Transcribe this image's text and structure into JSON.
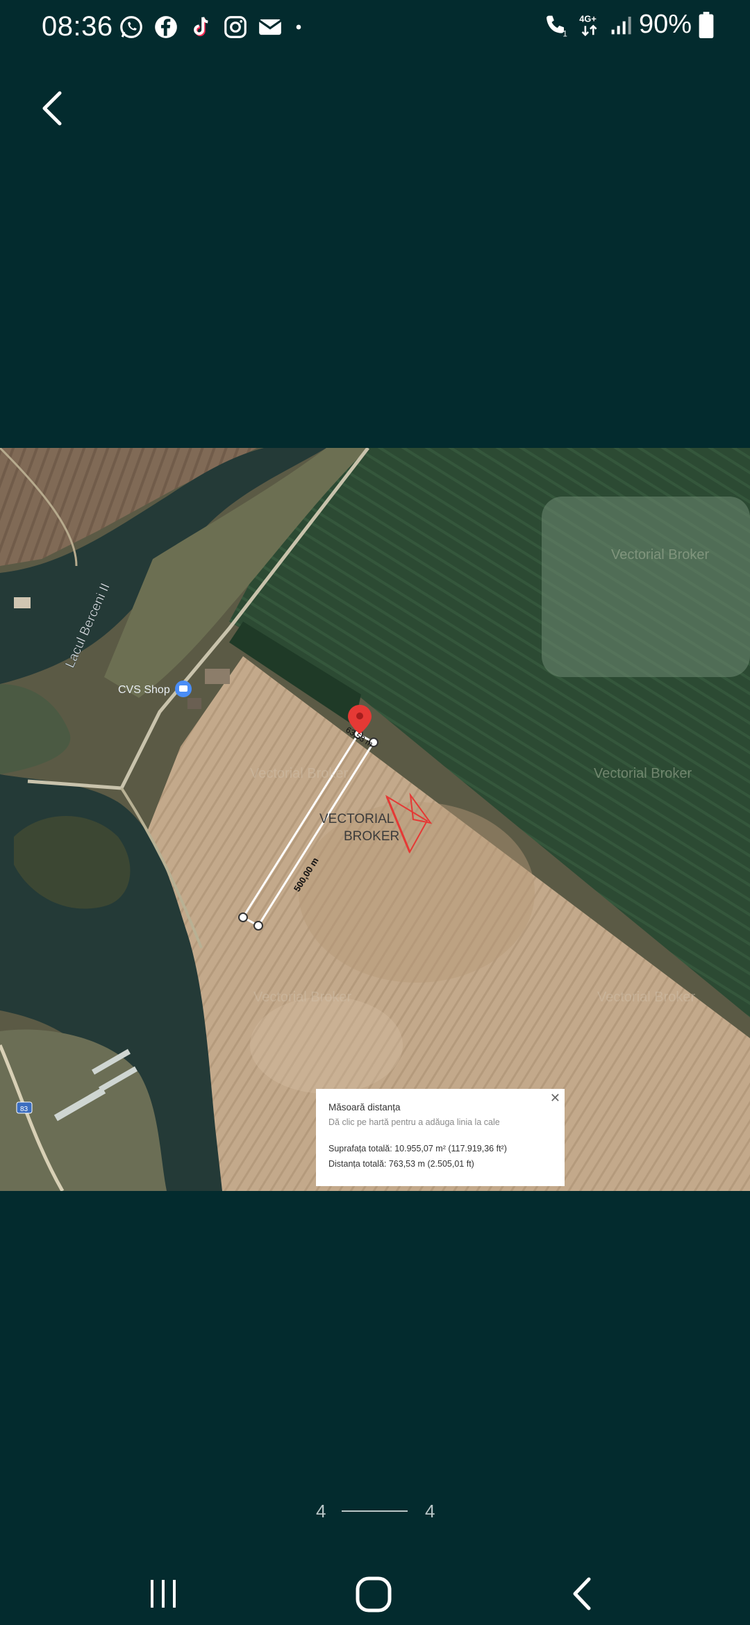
{
  "status_bar": {
    "time": "08:36",
    "notification_icons": [
      "whatsapp-icon",
      "facebook-icon",
      "tiktok-icon",
      "instagram-icon",
      "mail-icon",
      "dot-icon"
    ],
    "network": "4G+",
    "battery": "90%"
  },
  "map": {
    "labels": {
      "lake": "Lacul Berceni II",
      "shop": "CVS Shop",
      "road": "83"
    },
    "watermark": {
      "line1": "VECTORIAL",
      "line2": "BROKER",
      "faint": "Vectorial Broker"
    },
    "measure_labels": {
      "length": "500,00 m",
      "short": "63,53 m"
    },
    "measure_box": {
      "title": "Măsoară distanța",
      "hint": "Dă clic pe hartă pentru a adăuga linia la cale",
      "area": "Suprafața totală: 10.955,07 m² (117.919,36 ft²)",
      "distance": "Distanța totală: 763,53 m (2.505,01 ft)"
    }
  },
  "pager": {
    "current": "4",
    "total": "4"
  },
  "colors": {
    "background": "#032b2e",
    "pin": "#e53935",
    "watermark_red": "#e53935"
  }
}
